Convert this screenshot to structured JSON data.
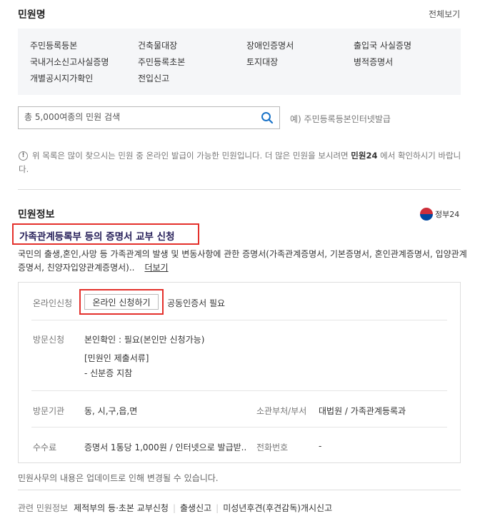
{
  "header": {
    "title": "민원명",
    "view_all": "전체보기"
  },
  "quick_links": [
    "주민등록등본",
    "건축물대장",
    "장애인증명서",
    "출입국 사실증명",
    "국내거소신고사실증명",
    "주민등록초본",
    "토지대장",
    "병적증명서",
    "개별공시지가확인",
    "전입신고"
  ],
  "search": {
    "placeholder": "총 5,000여종의 민원 검색",
    "example": "예) 주민등록등본인터넷발급"
  },
  "notice": {
    "before": "위 목록은 많이 찾으시는 민원 중 온라인 발급이 가능한 민원입니다. 더 많은 민원을 보시려면 ",
    "link": "민원24",
    "after": " 에서 확인하시기 바랍니다."
  },
  "info": {
    "title": "민원정보",
    "provider": "정부24",
    "petition_title": "가족관계등록부 등의 증명서 교부 신청",
    "description": "국민의 출생,혼인,사망 등 가족관계의 발생 및 변동사항에 관한 증명서(가족관계증명서, 기본증명서, 혼인관계증명서, 입양관계증명서, 친양자입양관계증명서)..",
    "more": "더보기",
    "online_label": "온라인신청",
    "apply_button": "온라인 신청하기",
    "cert_note": "공동인증서 필요",
    "visit_label": "방문신청",
    "visit_line1": "본인확인 : 필요(본인만 신청가능)",
    "visit_line2": "[민원인 제출서류]",
    "visit_line3": "- 신분증 지참",
    "office_label": "방문기관",
    "office_value": "동, 시,구,읍,면",
    "dept_label": "소관부처/부서",
    "dept_value": "대법원 / 가족관계등록과",
    "fee_label": "수수료",
    "fee_value": "증명서 1통당 1,000원 / 인터넷으로 발급받..",
    "phone_label": "전화번호",
    "phone_value": "-"
  },
  "footnote": "민원사무의 내용은 업데이트로 인해 변경될 수 있습니다.",
  "related": {
    "label": "관련 민원정보",
    "links": [
      "제적부의 등·초본 교부신청",
      "출생신고",
      "미성년후견(후견감독)개시신고"
    ]
  },
  "colors": {
    "highlight": "#e4302b",
    "title_text": "#27205a",
    "search_icon": "#1a73c8"
  }
}
